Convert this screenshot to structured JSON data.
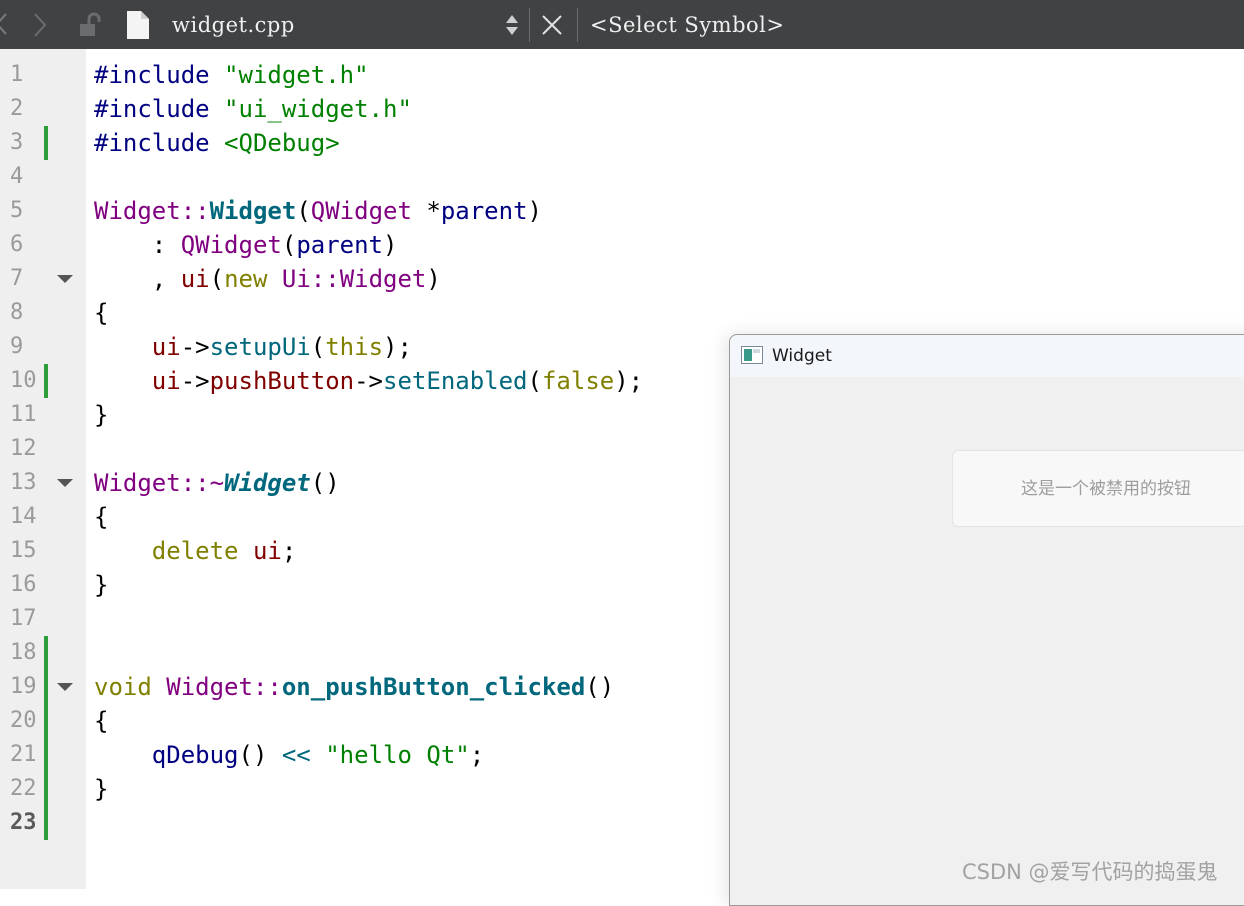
{
  "toolbar": {
    "file_name": "widget.cpp",
    "symbol_selector": "<Select Symbol>"
  },
  "editor": {
    "line_numbers": [
      "1",
      "2",
      "3",
      "4",
      "5",
      "6",
      "7",
      "8",
      "9",
      "10",
      "11",
      "12",
      "13",
      "14",
      "15",
      "16",
      "17",
      "18",
      "19",
      "20",
      "21",
      "22",
      "23"
    ],
    "current_line": "23",
    "code": {
      "l1_kw": "#include ",
      "l1_str": "\"widget.h\"",
      "l2_kw": "#include ",
      "l2_str": "\"ui_widget.h\"",
      "l3_kw": "#include ",
      "l3_str": "<QDebug>",
      "l5_a": "Widget",
      "l5_b": "::",
      "l5_c": "Widget",
      "l5_d": "(",
      "l5_e": "QWidget",
      "l5_f": " *",
      "l5_g": "parent",
      "l5_h": ")",
      "l6_a": "    : ",
      "l6_b": "QWidget",
      "l6_c": "(",
      "l6_d": "parent",
      "l6_e": ")",
      "l7_a": "    , ",
      "l7_b": "ui",
      "l7_c": "(",
      "l7_d": "new",
      "l7_e": " ",
      "l7_f": "Ui",
      "l7_g": "::",
      "l7_h": "Widget",
      "l7_i": ")",
      "l8": "{",
      "l9_a": "    ",
      "l9_b": "ui",
      "l9_c": "->",
      "l9_d": "setupUi",
      "l9_e": "(",
      "l9_f": "this",
      "l9_g": ");",
      "l10_a": "    ",
      "l10_b": "ui",
      "l10_c": "->",
      "l10_d": "pushButton",
      "l10_e": "->",
      "l10_f": "setEnabled",
      "l10_g": "(",
      "l10_h": "false",
      "l10_i": ");",
      "l11": "}",
      "l13_a": "Widget",
      "l13_b": "::~",
      "l13_c": "Widget",
      "l13_d": "()",
      "l14": "{",
      "l15_a": "    ",
      "l15_b": "delete",
      "l15_c": " ",
      "l15_d": "ui",
      "l15_e": ";",
      "l16": "}",
      "l19_a": "void",
      "l19_b": " ",
      "l19_c": "Widget",
      "l19_d": "::",
      "l19_e": "on_pushButton_clicked",
      "l19_f": "()",
      "l20": "{",
      "l21_a": "    ",
      "l21_b": "qDebug",
      "l21_c": "() ",
      "l21_d": "<<",
      "l21_e": " ",
      "l21_f": "\"hello Qt\"",
      "l21_g": ";",
      "l22": "}"
    }
  },
  "widget_window": {
    "title": "Widget",
    "button_label": "这是一个被禁用的按钮"
  },
  "watermark": "CSDN @爱写代码的捣蛋鬼"
}
